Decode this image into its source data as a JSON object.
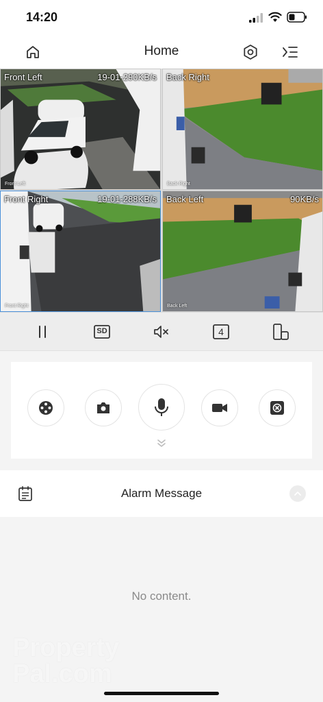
{
  "status_bar": {
    "time": "14:20"
  },
  "nav": {
    "title": "Home"
  },
  "cameras": [
    {
      "name": "Front Left",
      "rate": "19-01-290KB/s",
      "osd": "Front Left"
    },
    {
      "name": "Back Right",
      "rate": "",
      "osd": "Back Right"
    },
    {
      "name": "Front Right",
      "rate": "19-01-288KB/s",
      "osd": "Front Right"
    },
    {
      "name": "Back Left",
      "rate": "90KB/s",
      "osd": "Back Left"
    }
  ],
  "controls": {
    "pause_icon": "pause-icon",
    "quality_label": "SD",
    "mute_icon": "mute-icon",
    "split_label": "4",
    "rotate_icon": "rotate-screen-icon"
  },
  "actions": [
    {
      "icon": "ptz-control-icon"
    },
    {
      "icon": "camera-snapshot-icon"
    },
    {
      "icon": "microphone-icon"
    },
    {
      "icon": "video-record-icon"
    },
    {
      "icon": "close-stream-icon"
    }
  ],
  "alarm": {
    "title": "Alarm Message",
    "empty_text": "No content."
  },
  "watermark": {
    "line1": "Property",
    "line2": "Pal.com"
  },
  "colors": {
    "accent": "#4a90d9",
    "panel_bg": "#ffffff",
    "page_bg": "#f4f4f4"
  }
}
